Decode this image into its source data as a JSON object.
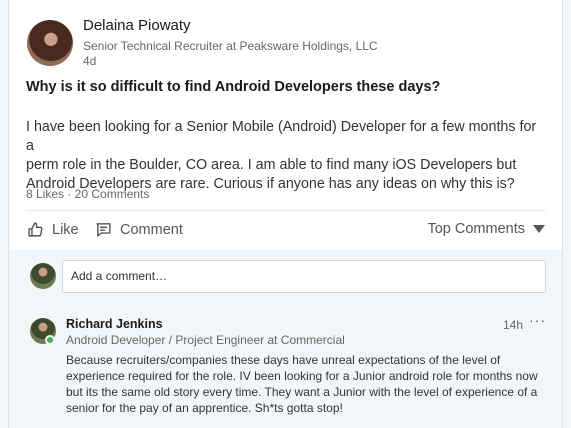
{
  "post": {
    "author_name": "Delaina Piowaty",
    "author_title": "Senior Technical Recruiter at Peaksware Holdings, LLC",
    "age": "4d",
    "heading": "Why is it so difficult to find Android Developers these days?",
    "body_lines": [
      "I have been looking for a Senior Mobile (Android) Developer for a few months for a",
      "perm role in the Boulder, CO area.  I am able to find many iOS Developers but",
      "Android Developers are rare. Curious if anyone has any ideas on why this is?"
    ],
    "stats": "8 Likes · 20 Comments"
  },
  "actions": {
    "like_label": "Like",
    "comment_label": "Comment",
    "sort_label": "Top Comments"
  },
  "comment_input": {
    "placeholder": "Add a comment…"
  },
  "comments": [
    {
      "name": "Richard Jenkins",
      "title": "Android Developer / Project Engineer at Commercial",
      "time": "14h",
      "more": "···",
      "lines": [
        "Because recruiters/companies these days have unreal expectations of the level of",
        "experience required for the role. IV been looking for a Junior android role for months now",
        "but its the same old story every time. They want a Junior with the level of experience of a",
        "senior for the pay of an apprentice. Sh*ts gotta stop!"
      ]
    }
  ],
  "icons": {
    "like": "thumbs-up-icon",
    "comment": "comment-icon",
    "sort": "caret-down-icon",
    "more": "more-icon"
  },
  "colors": {
    "page_bg": "#f3f6f8",
    "card_bg": "#ffffff",
    "online": "#4caf50",
    "muted_text": "#666666"
  }
}
